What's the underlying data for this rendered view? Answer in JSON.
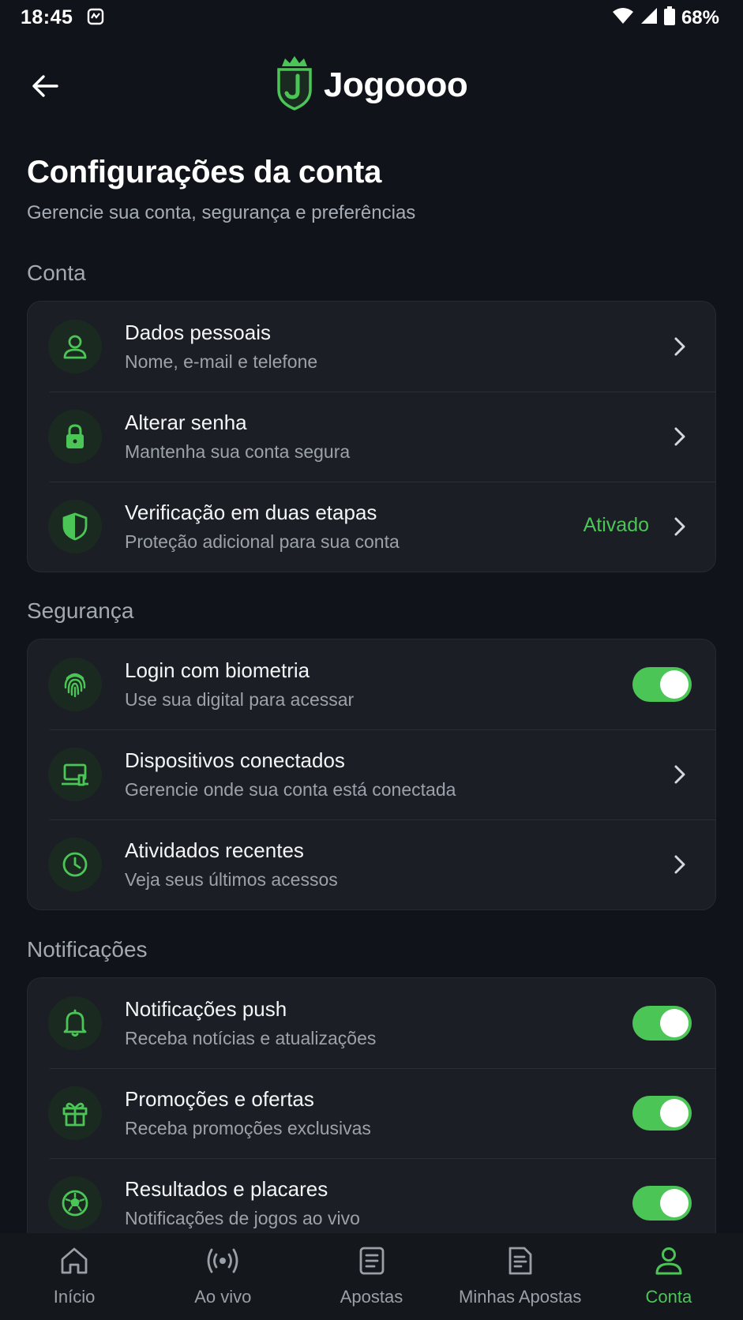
{
  "status_bar": {
    "time": "18:45",
    "battery": "68%"
  },
  "header": {
    "app_name": "Jogoooo"
  },
  "page": {
    "title": "Configurações da conta",
    "subtitle": "Gerencie sua conta, segurança e preferências"
  },
  "sections": {
    "conta": {
      "label": "Conta",
      "items": [
        {
          "title": "Dados pessoais",
          "subtitle": "Nome, e-mail e telefone",
          "icon": "user-icon"
        },
        {
          "title": "Alterar senha",
          "subtitle": "Mantenha sua conta segura",
          "icon": "lock-icon"
        },
        {
          "title": "Verificação em duas etapas",
          "subtitle": "Proteção adicional para sua conta",
          "icon": "shield-icon",
          "status": "Ativado"
        }
      ]
    },
    "seguranca": {
      "label": "Segurança",
      "items": [
        {
          "title": "Login com biometria",
          "subtitle": "Use sua digital para acessar",
          "icon": "fingerprint-icon",
          "enabled": true
        },
        {
          "title": "Dispositivos conectados",
          "subtitle": "Gerencie onde sua conta está conectada",
          "icon": "laptop-icon"
        },
        {
          "title": "Atividados recentes",
          "subtitle": "Veja seus últimos acessos",
          "icon": "clock-icon"
        }
      ]
    },
    "notificacoes": {
      "label": "Notificações",
      "items": [
        {
          "title": "Notificações push",
          "subtitle": "Receba notícias e atualizações",
          "icon": "bell-icon",
          "enabled": true
        },
        {
          "title": "Promoções e ofertas",
          "subtitle": "Receba promoções exclusivas",
          "icon": "gift-icon",
          "enabled": true
        },
        {
          "title": "Resultados e placares",
          "subtitle": "Notificações de jogos ao vivo",
          "icon": "soccer-ball-icon",
          "enabled": true
        }
      ]
    }
  },
  "bottom_nav": {
    "items": [
      {
        "label": "Início",
        "icon": "home-icon"
      },
      {
        "label": "Ao vivo",
        "icon": "live-broadcast-icon"
      },
      {
        "label": "Apostas",
        "icon": "bet-slip-icon"
      },
      {
        "label": "Minhas Apostas",
        "icon": "my-bets-icon"
      },
      {
        "label": "Conta",
        "icon": "user-icon",
        "active": true
      }
    ]
  },
  "colors": {
    "background": "#101319",
    "card": "#1b1e24",
    "accent": "#4cc557",
    "muted_text": "#9ca2ab"
  }
}
